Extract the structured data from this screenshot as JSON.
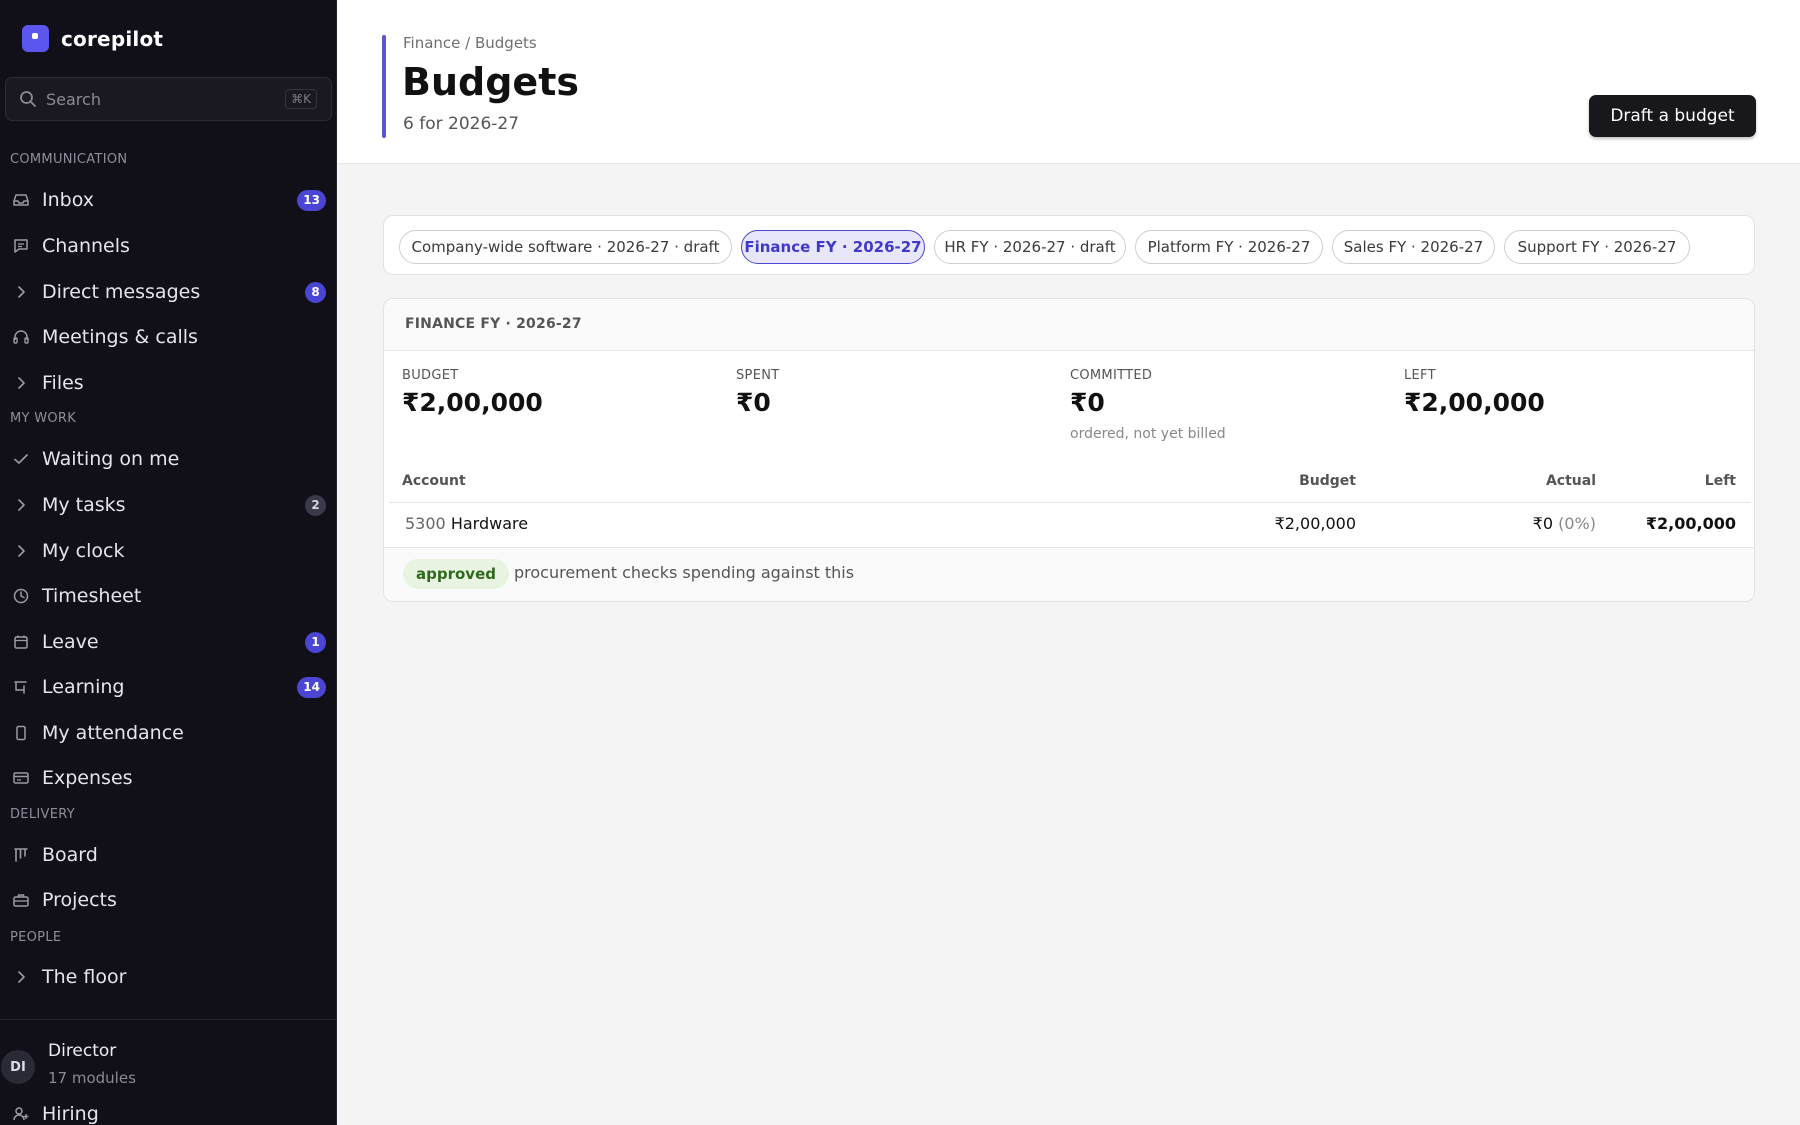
{
  "brand": {
    "name": "corepilot"
  },
  "search": {
    "placeholder": "Search",
    "shortcut": "⌘K"
  },
  "sidebar": {
    "sections": [
      {
        "label": "COMMUNICATION"
      },
      {
        "label": "MY WORK"
      },
      {
        "label": "DELIVERY"
      },
      {
        "label": "PEOPLE"
      }
    ],
    "items": [
      {
        "label": "Inbox",
        "icon": "inbox-icon",
        "badge": "13"
      },
      {
        "label": "Channels",
        "icon": "chat-icon"
      },
      {
        "label": "Direct messages",
        "icon": "chevron-right-icon",
        "badge": "8"
      },
      {
        "label": "Meetings & calls",
        "icon": "headset-icon"
      },
      {
        "label": "Files",
        "icon": "chevron-right-icon"
      },
      {
        "label": "Waiting on me",
        "icon": "check-icon"
      },
      {
        "label": "My tasks",
        "icon": "chevron-right-icon",
        "badge": "2"
      },
      {
        "label": "My clock",
        "icon": "chevron-right-icon"
      },
      {
        "label": "Timesheet",
        "icon": "clock-icon"
      },
      {
        "label": "Leave",
        "icon": "calendar-icon",
        "badge": "1"
      },
      {
        "label": "Learning",
        "icon": "presentation-icon",
        "badge": "14"
      },
      {
        "label": "My attendance",
        "icon": "phone-icon"
      },
      {
        "label": "Expenses",
        "icon": "card-icon"
      },
      {
        "label": "Board",
        "icon": "kanban-icon"
      },
      {
        "label": "Projects",
        "icon": "briefcase-icon"
      },
      {
        "label": "The floor",
        "icon": "chevron-right-icon"
      },
      {
        "label": "Hiring",
        "icon": "user-plus-icon"
      }
    ]
  },
  "user": {
    "initials": "DI",
    "name": "Director",
    "subtitle": "17 modules"
  },
  "header": {
    "breadcrumb": "Finance / Budgets",
    "title": "Budgets",
    "subtitle": "6 for 2026-27",
    "primary_action": "Draft a budget"
  },
  "tabs": [
    {
      "label": "Company-wide software · 2026-27 · draft",
      "active": false
    },
    {
      "label": "Finance FY · 2026-27",
      "active": true
    },
    {
      "label": "HR FY · 2026-27 · draft",
      "active": false
    },
    {
      "label": "Platform FY · 2026-27",
      "active": false
    },
    {
      "label": "Sales FY · 2026-27",
      "active": false
    },
    {
      "label": "Support FY · 2026-27",
      "active": false
    }
  ],
  "budget": {
    "title": "FINANCE FY · 2026-27",
    "stats": [
      {
        "label": "BUDGET",
        "value": "₹2,00,000"
      },
      {
        "label": "SPENT",
        "value": "₹0"
      },
      {
        "label": "COMMITTED",
        "value": "₹0",
        "note": "ordered, not yet billed"
      },
      {
        "label": "LEFT",
        "value": "₹2,00,000"
      }
    ],
    "columns": [
      "Account",
      "Budget",
      "Actual",
      "Left"
    ],
    "rows": [
      {
        "code": "5300",
        "name": "Hardware",
        "budget": "₹2,00,000",
        "actual": "₹0",
        "actual_pct": "(0%)",
        "left": "₹2,00,000"
      }
    ],
    "status": "approved",
    "status_note": "procurement checks spending against this"
  }
}
